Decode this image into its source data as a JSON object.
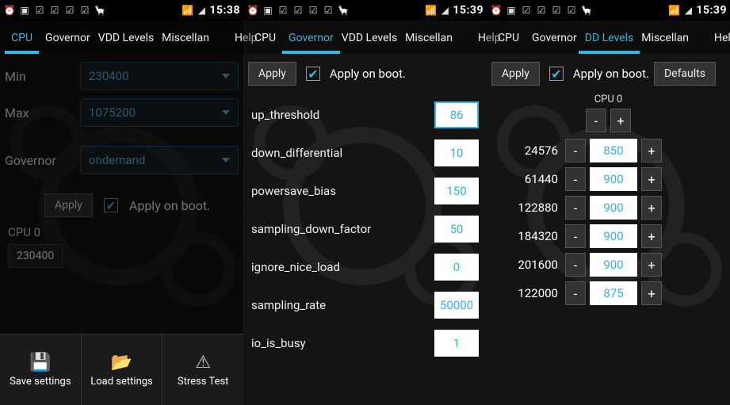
{
  "status": {
    "time1": "15:38",
    "time2": "15:39",
    "time3": "15:39"
  },
  "tabs": {
    "cpu": "CPU",
    "governor": "Governor",
    "vdd": "VDD Levels",
    "vdd_trunc": "DD Levels",
    "misc": "Miscellan",
    "help": "Help"
  },
  "screen1": {
    "min_label": "Min",
    "min_val": "230400",
    "max_label": "Max",
    "max_val": "1075200",
    "gov_label": "Governor",
    "gov_val": "ondemand",
    "apply": "Apply",
    "apply_boot": "Apply on boot.",
    "cpu0_label": "CPU 0",
    "cpu0_freq": "230400",
    "menu": {
      "save": "Save settings",
      "load": "Load settings",
      "stress": "Stress Test"
    }
  },
  "screen2": {
    "apply": "Apply",
    "apply_boot": "Apply on boot.",
    "params": [
      {
        "name": "up_threshold",
        "val": "86",
        "focus": true
      },
      {
        "name": "down_differential",
        "val": "10"
      },
      {
        "name": "powersave_bias",
        "val": "150"
      },
      {
        "name": "sampling_down_factor",
        "val": "50"
      },
      {
        "name": "ignore_nice_load",
        "val": "0"
      },
      {
        "name": "sampling_rate",
        "val": "50000"
      },
      {
        "name": "io_is_busy",
        "val": "1"
      }
    ]
  },
  "screen3": {
    "apply": "Apply",
    "apply_boot": "Apply on boot.",
    "defaults": "Defaults",
    "cpu_hdr": "CPU 0",
    "minus": "-",
    "plus": "+",
    "rows": [
      {
        "freq": "24576",
        "val": "850"
      },
      {
        "freq": "61440",
        "val": "900"
      },
      {
        "freq": "122880",
        "val": "900"
      },
      {
        "freq": "184320",
        "val": "900"
      },
      {
        "freq": "201600",
        "val": "900"
      },
      {
        "freq": "122000",
        "val": "875"
      }
    ]
  }
}
